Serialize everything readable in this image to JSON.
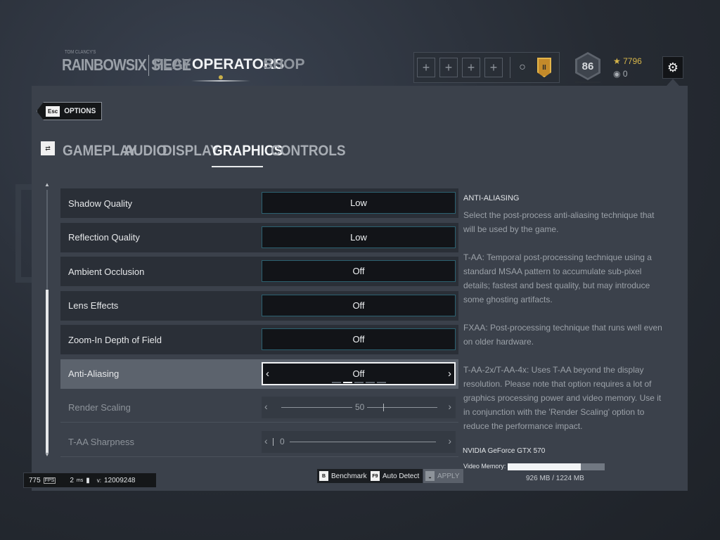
{
  "nav": {
    "logo": "RAINBOWSIX",
    "logo_sub": "SIEGE",
    "logo_small": "TOM CLANCY'S",
    "items": [
      "PLAY",
      "OPERATORS",
      "SHOP"
    ],
    "active": "OPERATORS"
  },
  "squad": {
    "slots": [
      "+",
      "+",
      "+",
      "+"
    ]
  },
  "level": "86",
  "currency": {
    "renown": "7796",
    "r6": "0"
  },
  "back": {
    "key": "Esc",
    "label": "OPTIONS"
  },
  "tabs": [
    "GAMEPLAY",
    "AUDIO",
    "DISPLAY",
    "GRAPHICS",
    "CONTROLS"
  ],
  "active_tab": "GRAPHICS",
  "settings": [
    {
      "name": "Shadow Quality",
      "value": "Low"
    },
    {
      "name": "Reflection Quality",
      "value": "Low"
    },
    {
      "name": "Ambient Occlusion",
      "value": "Off"
    },
    {
      "name": "Lens Effects",
      "value": "Off"
    },
    {
      "name": "Zoom-In Depth of Field",
      "value": "Off"
    },
    {
      "name": "Anti-Aliasing",
      "value": "Off"
    },
    {
      "name": "Render Scaling",
      "value": "50"
    },
    {
      "name": "T-AA Sharpness",
      "value": "0"
    }
  ],
  "anti_aliasing_option_count": 5,
  "anti_aliasing_selected_index": 1,
  "render_scaling_fraction": 0.5,
  "taa_sharpness_fraction": 0.0,
  "description": {
    "title": "ANTI-ALIASING",
    "paragraphs": [
      "Select the post-process anti-aliasing technique that will be used by the game.",
      "T-AA: Temporal post-processing technique using a standard MSAA pattern to accumulate sub-pixel details; fastest and best quality, but may introduce some ghosting artifacts.",
      "FXAA: Post-processing technique that runs well even on older hardware.",
      "T-AA-2x/T-AA-4x: Uses T-AA beyond the display resolution. Please note that option requires a lot of graphics processing power and video memory. Use it in conjunction with the 'Render Scaling' option to reduce the performance impact."
    ]
  },
  "gpu": {
    "name": "NVIDIA GeForce GTX 570",
    "vram_label": "Video Memory:",
    "vram_text": "926 MB / 1224 MB",
    "vram_used": 926,
    "vram_total": 1224
  },
  "buttons": {
    "benchmark": {
      "key": "B",
      "label": "Benchmark"
    },
    "auto_detect": {
      "key": "F9",
      "label": "Auto Detect"
    },
    "apply": {
      "key": "",
      "label": "APPLY"
    }
  },
  "stats": {
    "fps": "775",
    "fps_unit": "FPS",
    "ping": "2",
    "ping_unit": "ms",
    "version_label": "v:",
    "version": "12009248"
  }
}
